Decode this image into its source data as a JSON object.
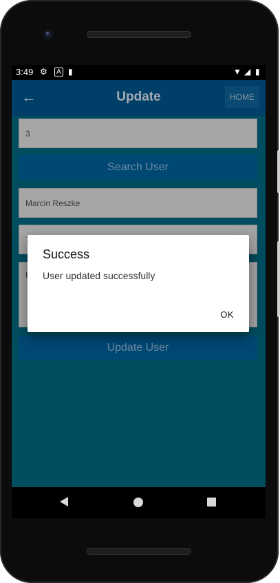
{
  "status_bar": {
    "time": "3:49"
  },
  "app_bar": {
    "title": "Update",
    "home_button": "HOME"
  },
  "form": {
    "user_id_value": "3",
    "search_button": "Search User",
    "name_value": "Marcin Reszke",
    "contact_partial": "7",
    "address_partial": "K",
    "update_button": "Update User"
  },
  "dialog": {
    "title": "Success",
    "message": "User updated successfully",
    "ok_button": "OK"
  },
  "colors": {
    "screen_bg": "#004d60",
    "app_bar": "#003f68",
    "button": "#004874",
    "field": "#a6a6a6"
  }
}
